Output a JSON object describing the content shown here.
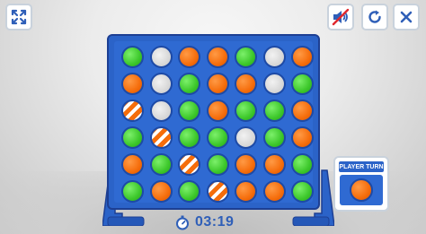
{
  "toolbar": {
    "fullscreen_icon": "expand-arrows-icon",
    "sound_icon": "speaker-muted-icon",
    "restart_icon": "restart-icon",
    "close_icon": "close-x-icon"
  },
  "board": {
    "columns": 7,
    "rows": 6,
    "grid": [
      [
        "green",
        "empty",
        "orange",
        "orange",
        "green",
        "empty",
        "orange"
      ],
      [
        "orange",
        "empty",
        "green",
        "orange",
        "orange",
        "empty",
        "green"
      ],
      [
        "hl",
        "empty",
        "green",
        "orange",
        "green",
        "green",
        "orange"
      ],
      [
        "green",
        "hl",
        "green",
        "green",
        "empty",
        "green",
        "orange"
      ],
      [
        "orange",
        "green",
        "hl",
        "green",
        "orange",
        "orange",
        "green"
      ],
      [
        "green",
        "orange",
        "green",
        "hl",
        "orange",
        "orange",
        "green"
      ]
    ],
    "colors": {
      "green": "#3cc72a",
      "orange": "#f56d0b",
      "board": "#2b63c8"
    }
  },
  "timer": {
    "value": "03:19",
    "icon": "stopwatch-icon"
  },
  "turn_panel": {
    "label": "PLAYER TURN",
    "current_player_color": "orange"
  }
}
